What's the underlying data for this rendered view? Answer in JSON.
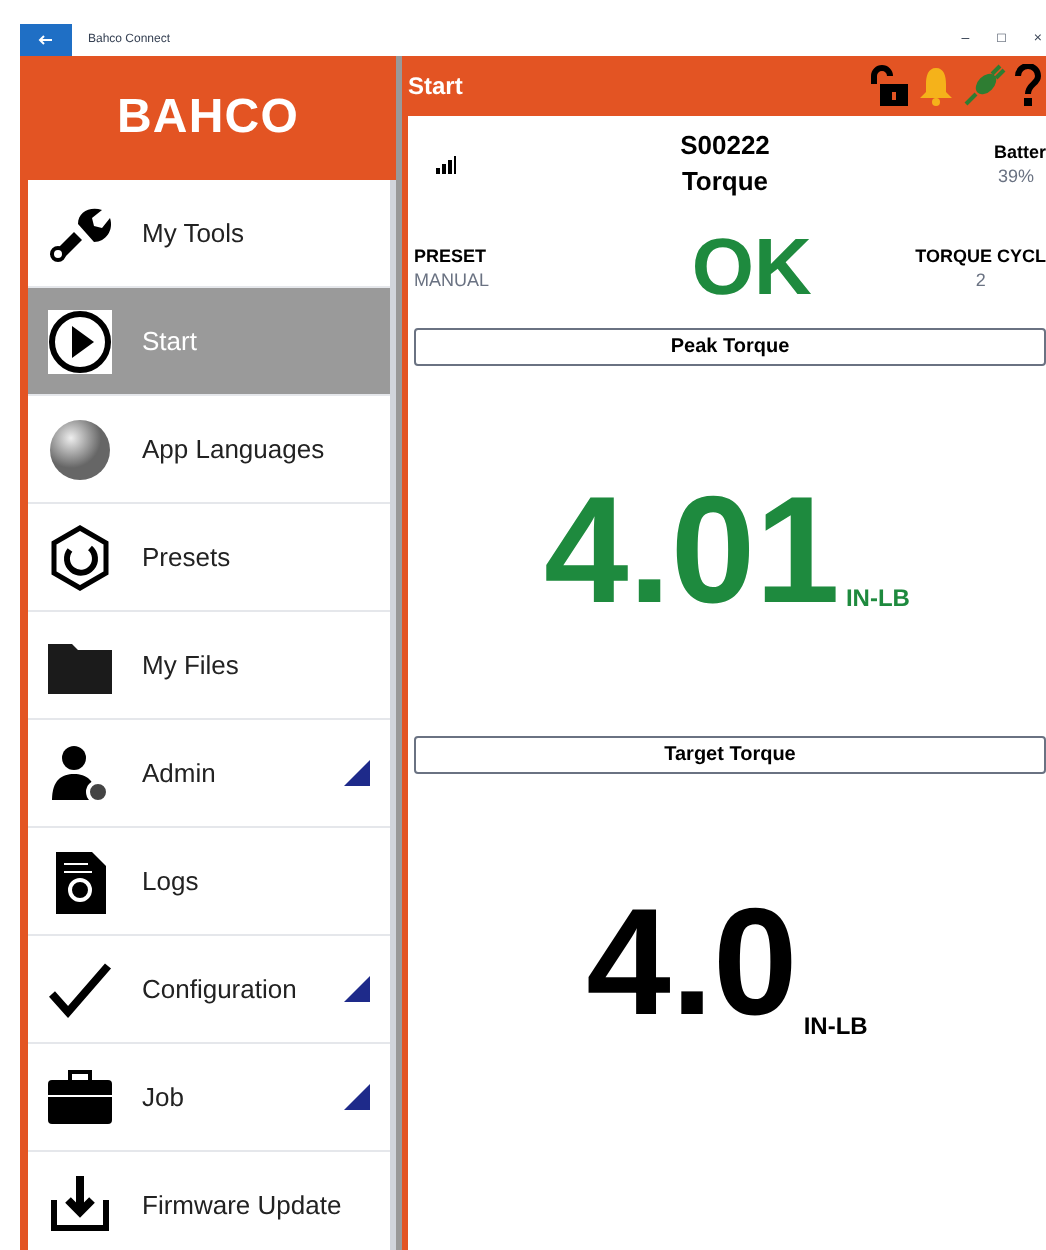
{
  "window": {
    "title": "Bahco Connect",
    "controls": [
      "–",
      "□",
      "×"
    ]
  },
  "sidebar": {
    "logo": "BAHCO",
    "items": [
      {
        "label": "My Tools",
        "selected": false,
        "expandable": false
      },
      {
        "label": "Start",
        "selected": true,
        "expandable": false
      },
      {
        "label": "App Languages",
        "selected": false,
        "expandable": false
      },
      {
        "label": "Presets",
        "selected": false,
        "expandable": false
      },
      {
        "label": "My Files",
        "selected": false,
        "expandable": false
      },
      {
        "label": "Admin",
        "selected": false,
        "expandable": true
      },
      {
        "label": "Logs",
        "selected": false,
        "expandable": false
      },
      {
        "label": "Configuration",
        "selected": false,
        "expandable": true
      },
      {
        "label": "Job",
        "selected": false,
        "expandable": true
      },
      {
        "label": "Firmware Update",
        "selected": false,
        "expandable": false
      }
    ]
  },
  "header": {
    "title": "Start"
  },
  "device": {
    "serial": "S00222",
    "mode": "Torque",
    "battery_label": "Batter",
    "battery_value": "39%"
  },
  "preset": {
    "label": "PRESET",
    "value": "MANUAL"
  },
  "status": "OK",
  "cycle": {
    "label": "TORQUE CYCL",
    "value": "2"
  },
  "peak": {
    "title": "Peak Torque",
    "value": "4.01",
    "unit": "IN-LB"
  },
  "target": {
    "title": "Target Torque",
    "value": "4.0",
    "unit": "IN-LB"
  }
}
